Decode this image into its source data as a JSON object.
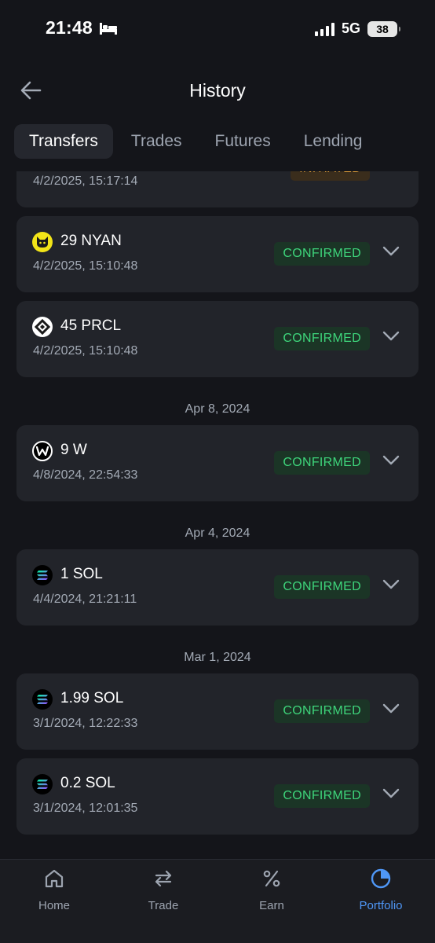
{
  "status_bar": {
    "time": "21:48",
    "network": "5G",
    "battery": "38"
  },
  "header": {
    "title": "History"
  },
  "tabs": [
    {
      "label": "Transfers",
      "active": true
    },
    {
      "label": "Trades",
      "active": false
    },
    {
      "label": "Futures",
      "active": false
    },
    {
      "label": "Lending",
      "active": false
    }
  ],
  "transfers": {
    "partial_item": {
      "timestamp": "4/2/2025, 15:17:14",
      "status": "INITIATED"
    },
    "group_1": [
      {
        "amount": "29 NYAN",
        "timestamp": "4/2/2025, 15:10:48",
        "status": "CONFIRMED",
        "icon": "nyan-cat-icon"
      },
      {
        "amount": "45 PRCL",
        "timestamp": "4/2/2025, 15:10:48",
        "status": "CONFIRMED",
        "icon": "prcl-icon"
      }
    ],
    "group_2_date": "Apr 8, 2024",
    "group_2": [
      {
        "amount": "9 W",
        "timestamp": "4/8/2024, 22:54:33",
        "status": "CONFIRMED",
        "icon": "wormhole-w-icon"
      }
    ],
    "group_3_date": "Apr 4, 2024",
    "group_3": [
      {
        "amount": "1 SOL",
        "timestamp": "4/4/2024, 21:21:11",
        "status": "CONFIRMED",
        "icon": "solana-icon"
      }
    ],
    "group_4_date": "Mar 1, 2024",
    "group_4": [
      {
        "amount": "1.99 SOL",
        "timestamp": "3/1/2024, 12:22:33",
        "status": "CONFIRMED",
        "icon": "solana-icon"
      },
      {
        "amount": "0.2 SOL",
        "timestamp": "3/1/2024, 12:01:35",
        "status": "CONFIRMED",
        "icon": "solana-icon"
      }
    ]
  },
  "bottom_nav": [
    {
      "label": "Home",
      "icon": "home-icon",
      "active": false
    },
    {
      "label": "Trade",
      "icon": "swap-arrows-icon",
      "active": false
    },
    {
      "label": "Earn",
      "icon": "percent-icon",
      "active": false
    },
    {
      "label": "Portfolio",
      "icon": "pie-chart-icon",
      "active": true
    }
  ],
  "colors": {
    "background": "#14151a",
    "card": "#22242a",
    "confirmed_text": "#3ed57b",
    "confirmed_bg": "#1b3526",
    "initiated_text": "#e4a23a",
    "accent": "#4f97f7",
    "muted_text": "#a3aab5"
  }
}
